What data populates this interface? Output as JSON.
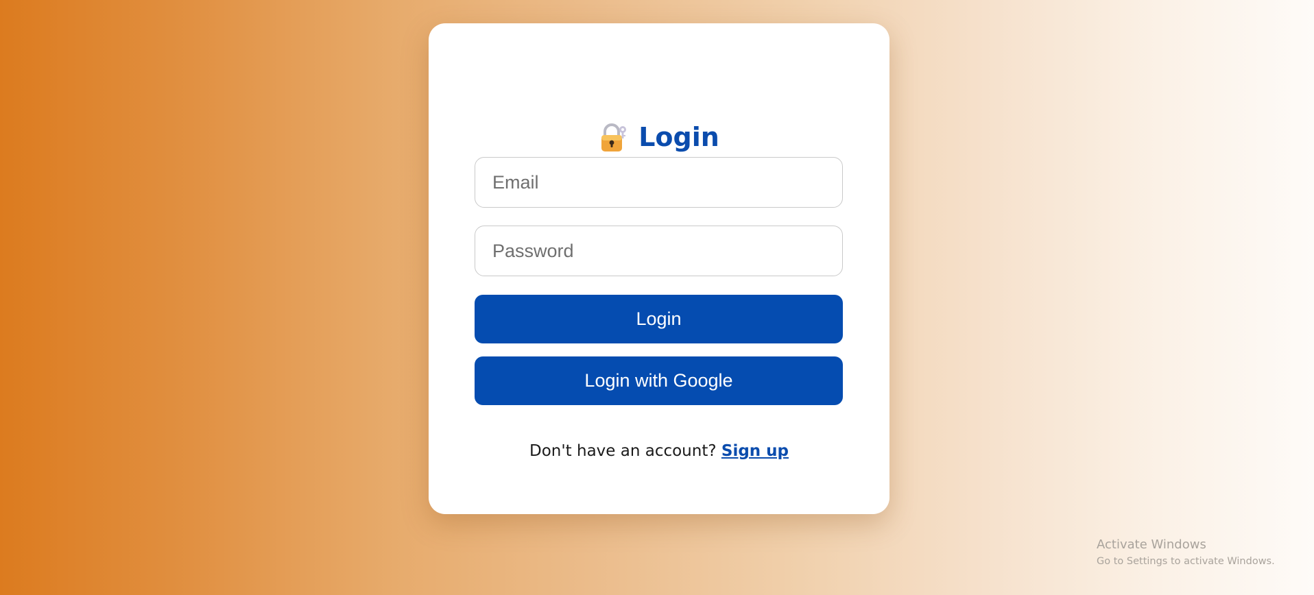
{
  "login_card": {
    "title": "Login",
    "title_icon": "lock-with-key-icon",
    "email_placeholder": "Email",
    "password_placeholder": "Password",
    "login_button_label": "Login",
    "google_button_label": "Login with Google",
    "signup_prompt": "Don't have an account? ",
    "signup_link_label": "Sign up"
  },
  "windows_watermark": {
    "title": "Activate Windows",
    "subtitle": "Go to Settings to activate Windows."
  },
  "colors": {
    "accent": "#054cb0",
    "title": "#0b4cad",
    "background_start": "#dc7b1f",
    "background_end": "#fefbf8"
  }
}
